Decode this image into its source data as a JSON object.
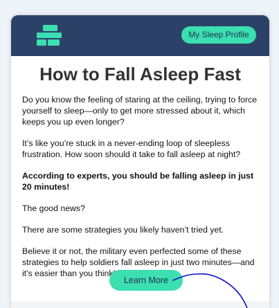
{
  "header": {
    "logo_icon": "brand-logo-icon",
    "profile_button_label": "My Sleep Profile",
    "background_color": "#2c4168",
    "accent_color": "#3bdfb0"
  },
  "article": {
    "title": "How to Fall Asleep Fast",
    "paragraphs": [
      "Do you know the feeling of staring at the ceiling, trying to force yourself to sleep—only to get more stressed about it, which keeps you up even longer?",
      "It’s like you’re stuck in a never-ending loop of sleepless frustration. How soon should it take to fall asleep at night?",
      "According to experts, you should be falling asleep in just 20 minutes!",
      "The good news?",
      "There are some strategies you likely haven’t tried yet.",
      "Believe it or not, the military even perfected some of these strategies to help soldiers fall asleep in just two minutes—and it's easier than you think!"
    ],
    "cta_label": "Learn More"
  },
  "annotation": {
    "stroke_color": "#1010d0"
  }
}
